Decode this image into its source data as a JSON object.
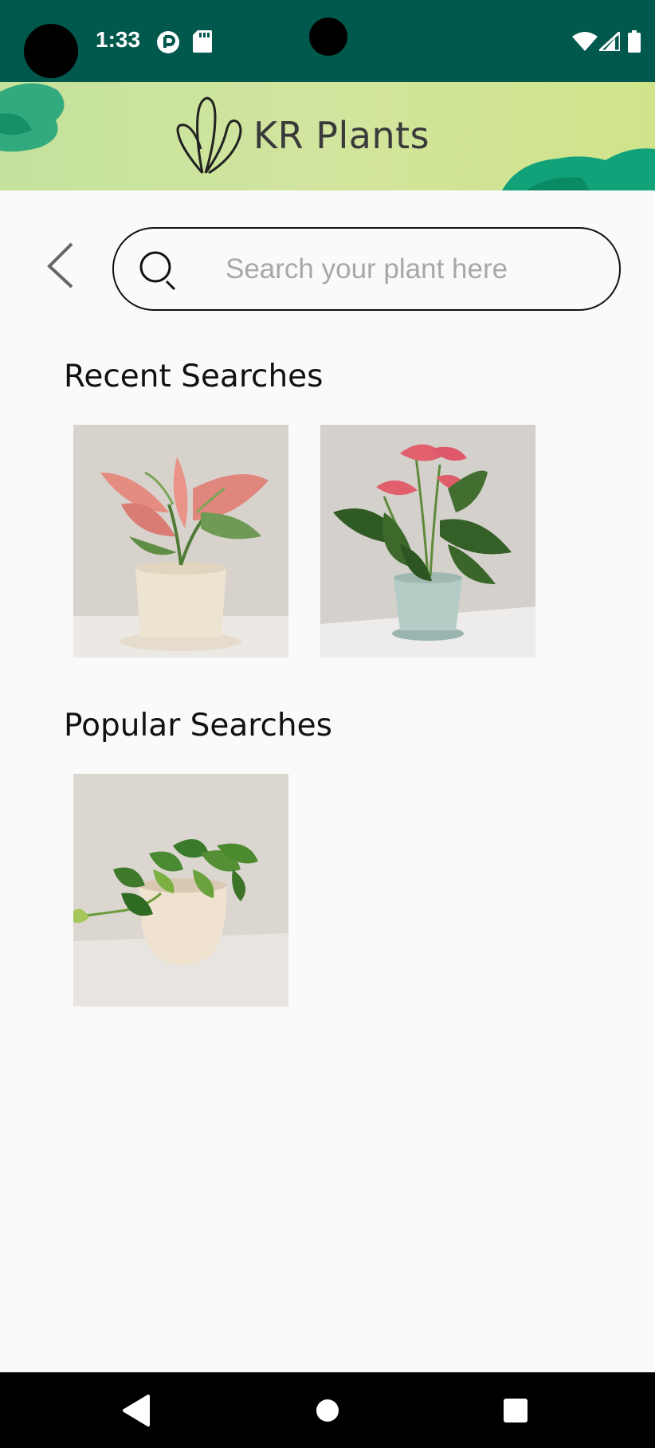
{
  "status": {
    "time": "1:33"
  },
  "header": {
    "brand": "KR Plants"
  },
  "search": {
    "placeholder": "Search your plant here",
    "value": ""
  },
  "sections": {
    "recent_title": "Recent Searches",
    "popular_title": "Popular Searches"
  },
  "colors": {
    "status_bar": "#01594d",
    "banner": "#cfe49a",
    "background": "#fafafa"
  }
}
